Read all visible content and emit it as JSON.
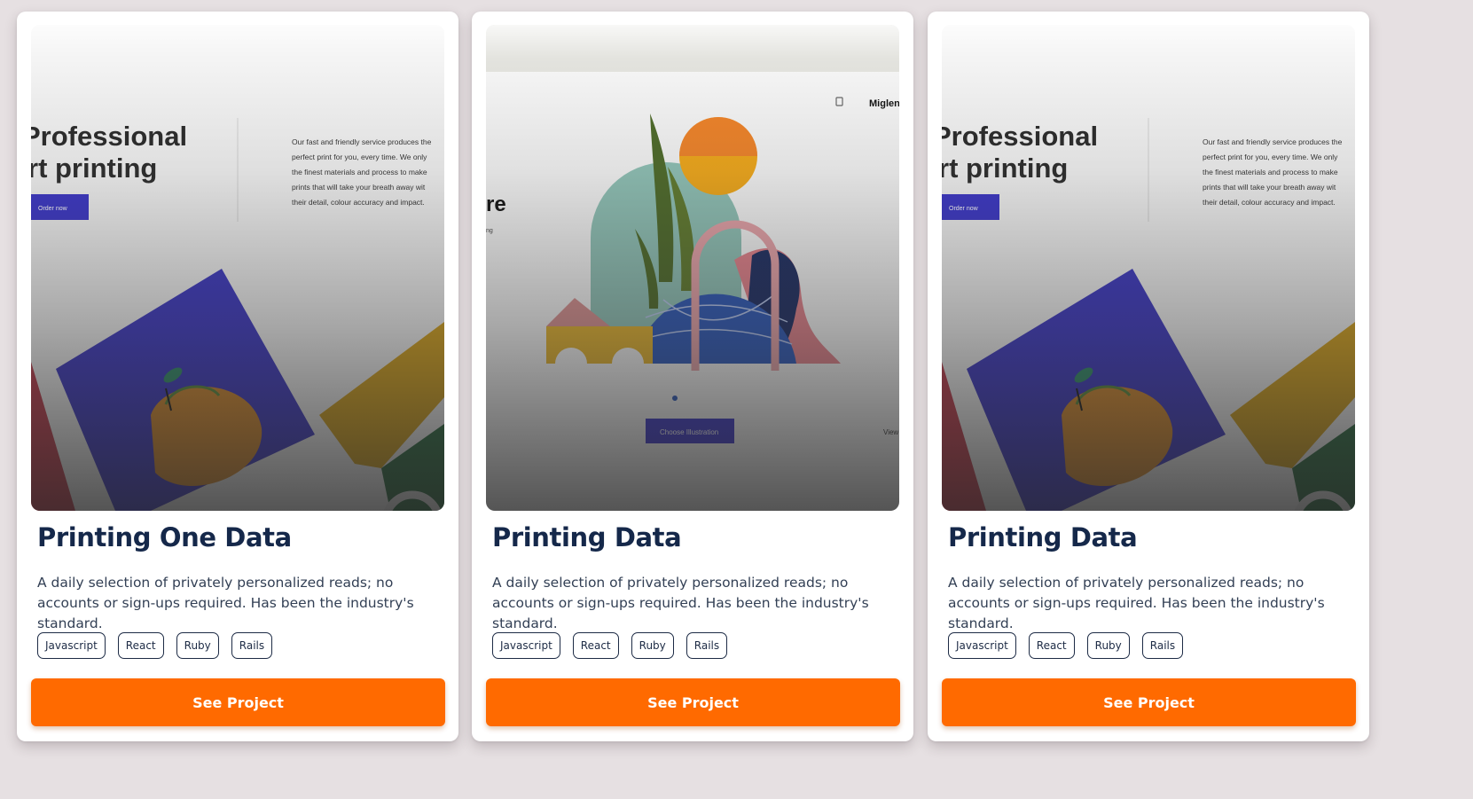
{
  "projects": [
    {
      "title": "Printing One Data",
      "description": "A daily selection of privately personalized reads; no accounts or sign-ups required. Has been the industry's standard.",
      "tags": [
        "Javascript",
        "React",
        "Ruby",
        "Rails"
      ],
      "button_label": "See Project",
      "preview": {
        "heading_line1": "Professional",
        "heading_line2": "rt printing",
        "cta": "Order now",
        "body_lines": [
          "Our fast and friendly service produces the",
          "perfect print for you, every time. We only",
          "the finest materials and process to make",
          "prints that will take your breath away wit",
          "their detail, colour accuracy and impact."
        ]
      }
    },
    {
      "title": "Printing Data",
      "description": "A daily selection of privately personalized reads; no accounts or sign-ups required. Has been the industry's standard.",
      "tags": [
        "Javascript",
        "React",
        "Ruby",
        "Rails"
      ],
      "button_label": "See Project",
      "preview": {
        "brand": "Miglen",
        "heading_fragment": "re",
        "sub_fragment": "ng",
        "cta": "Choose Illustration",
        "side_link": "View"
      }
    },
    {
      "title": "Printing Data",
      "description": "A daily selection of privately personalized reads; no accounts or sign-ups required. Has been the industry's standard.",
      "tags": [
        "Javascript",
        "React",
        "Ruby",
        "Rails"
      ],
      "button_label": "See Project",
      "preview": {
        "heading_line1": "Professional",
        "heading_line2": "rt printing",
        "cta": "Order now",
        "body_lines": [
          "Our fast and friendly service produces the",
          "perfect print for you, every time. We only",
          "the finest materials and process to make",
          "prints that will take your breath away wit",
          "their detail, colour accuracy and impact."
        ]
      }
    }
  ],
  "colors": {
    "page_background": "#e6e0e2",
    "card_background": "#ffffff",
    "title": "#15284a",
    "button": "#ff6a00",
    "tag_border": "#1d2b45"
  }
}
